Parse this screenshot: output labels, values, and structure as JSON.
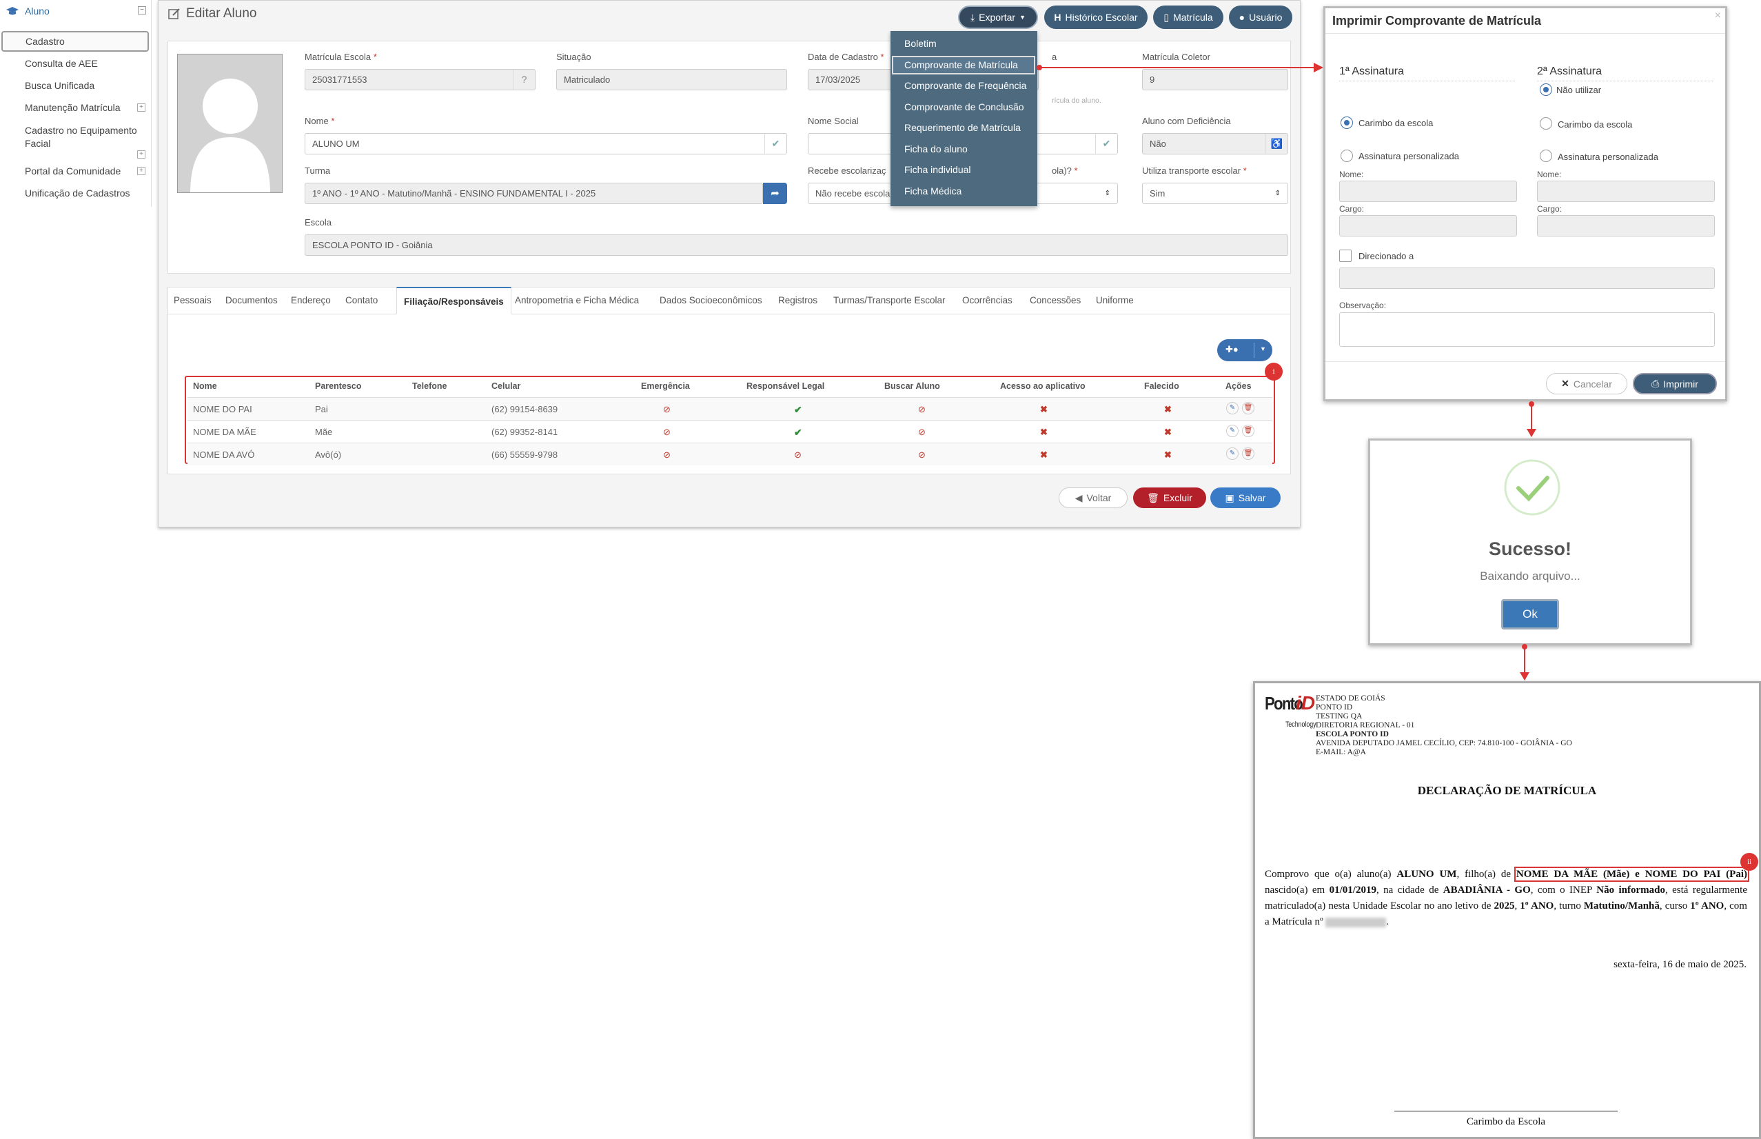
{
  "sidebar": {
    "section": "Aluno",
    "items": [
      {
        "label": "Cadastro"
      },
      {
        "label": "Consulta de AEE"
      },
      {
        "label": "Busca Unificada"
      },
      {
        "label": "Manutenção Matrícula"
      },
      {
        "label": "Cadastro no Equipamento Facial"
      },
      {
        "label": "Portal da Comunidade"
      },
      {
        "label": "Unificação de Cadastros"
      }
    ]
  },
  "page": {
    "title": "Editar Aluno"
  },
  "toolbar": {
    "exportar": "Exportar",
    "historico": "Histórico Escolar",
    "matricula": "Matrícula",
    "usuario": "Usuário"
  },
  "form": {
    "matricula_escola_label": "Matrícula Escola",
    "matricula_escola_value": "25031771553",
    "situacao_label": "Situação",
    "situacao_value": "Matriculado",
    "data_cadastro_label": "Data de Cadastro",
    "data_cadastro_value": "17/03/2025",
    "hidden_label_tail": "a",
    "hint_tail": "rícula do aluno.",
    "matricula_coletor_label": "Matrícula Coletor",
    "matricula_coletor_value": "9",
    "nome_label": "Nome",
    "nome_value": "ALUNO UM",
    "nome_social_label": "Nome Social",
    "deficiencia_label": "Aluno com Deficiência",
    "deficiencia_value": "Não",
    "turma_label": "Turma",
    "turma_value": "1º ANO - 1º ANO - Matutino/Manhã - ENSINO FUNDAMENTAL I - 2025",
    "recebe_label": "Recebe escolarizaç",
    "recebe_label_tail": "ola)?",
    "recebe_value": "Não recebe escolar",
    "transporte_label": "Utiliza transporte escolar",
    "transporte_value": "Sim",
    "escola_label": "Escola",
    "escola_value": "ESCOLA PONTO ID - Goiânia"
  },
  "tabs": [
    "Pessoais",
    "Documentos",
    "Endereço",
    "Contato",
    "Filiação/Responsáveis",
    "Antropometria e Ficha Médica",
    "Dados Socioeconômicos",
    "Registros",
    "Turmas/Transporte Escolar",
    "Ocorrências",
    "Concessões",
    "Uniforme"
  ],
  "table": {
    "columns": [
      "Nome",
      "Parentesco",
      "Telefone",
      "Celular",
      "Emergência",
      "Responsável Legal",
      "Buscar Aluno",
      "Acesso ao aplicativo",
      "Falecido",
      "Ações"
    ],
    "rows": [
      {
        "nome": "NOME DO PAI",
        "parentesco": "Pai",
        "telefone": "",
        "celular": "(62) 99154-8639",
        "emergencia": "no",
        "responsavel": "yes",
        "buscar": "no",
        "acesso": "x",
        "falecido": "x"
      },
      {
        "nome": "NOME DA MÃE",
        "parentesco": "Mãe",
        "telefone": "",
        "celular": "(62) 99352-8141",
        "emergencia": "no",
        "responsavel": "yes",
        "buscar": "no",
        "acesso": "x",
        "falecido": "x"
      },
      {
        "nome": "NOME DA AVÓ",
        "parentesco": "Avô(ó)",
        "telefone": "",
        "celular": "(66) 55559-9798",
        "emergencia": "no",
        "responsavel": "no",
        "buscar": "no",
        "acesso": "x",
        "falecido": "x"
      }
    ],
    "badge": "i"
  },
  "bottom_buttons": {
    "voltar": "Voltar",
    "excluir": "Excluir",
    "salvar": "Salvar"
  },
  "export_menu": [
    "Boletim",
    "Comprovante de Matrícula",
    "Comprovante de Frequência",
    "Comprovante de Conclusão",
    "Requerimento de Matrícula",
    "Ficha do aluno",
    "Ficha individual",
    "Ficha Médica"
  ],
  "print_modal": {
    "title": "Imprimir Comprovante de Matrícula",
    "close": "×",
    "sig1": "1ª Assinatura",
    "sig2": "2ª Assinatura",
    "nao_utilizar": "Não utilizar",
    "carimbo": "Carimbo da escola",
    "personalizada": "Assinatura personalizada",
    "nome": "Nome:",
    "cargo": "Cargo:",
    "direcionado": "Direcionado a",
    "observacao": "Observação:",
    "cancelar": "Cancelar",
    "imprimir": "Imprimir"
  },
  "success_modal": {
    "title": "Sucesso!",
    "message": "Baixando arquivo...",
    "ok": "Ok"
  },
  "document": {
    "logo_main": "Ponto",
    "logo_accent": "iD",
    "logo_sub": "Technology",
    "header": [
      "ESTADO DE GOIÁS",
      "PONTO ID",
      "TESTING QA",
      "DIRETORIA REGIONAL - 01",
      "ESCOLA PONTO ID",
      "AVENIDA DEPUTADO JAMEL CECÍLIO, CEP: 74.810-100 - GOIÂNIA - GO",
      "E-MAIL: A@A"
    ],
    "title": "DECLARAÇÃO DE MATRÍCULA",
    "p1": "Comprovo que o(a) aluno(a) ",
    "aluno": "ALUNO UM",
    "p2": ", filho(a) de ",
    "pais": "NOME DA MÃE (Mãe) e NOME DO PAI (Pai)",
    "p3": " nascido(a) em ",
    "nasc": "01/01/2019",
    "p4": ", na cidade de ",
    "cidade": "ABADIÂNIA - GO",
    "p5": ", com o INEP ",
    "inep": "Não informado",
    "p6": ", está regularmente matriculado(a) nesta Unidade Escolar no ano letivo de ",
    "ano": "2025",
    "p7": ", ",
    "serie": "1º ANO",
    "p8": ", turno ",
    "turno": "Matutino/Manhã",
    "p9": ", curso ",
    "curso": "1º ANO",
    "p10": ", com a Matrícula nº ",
    "p11": ".",
    "date": "sexta-feira, 16 de maio de 2025.",
    "signature": "Carimbo da Escola",
    "badge": "ii"
  }
}
